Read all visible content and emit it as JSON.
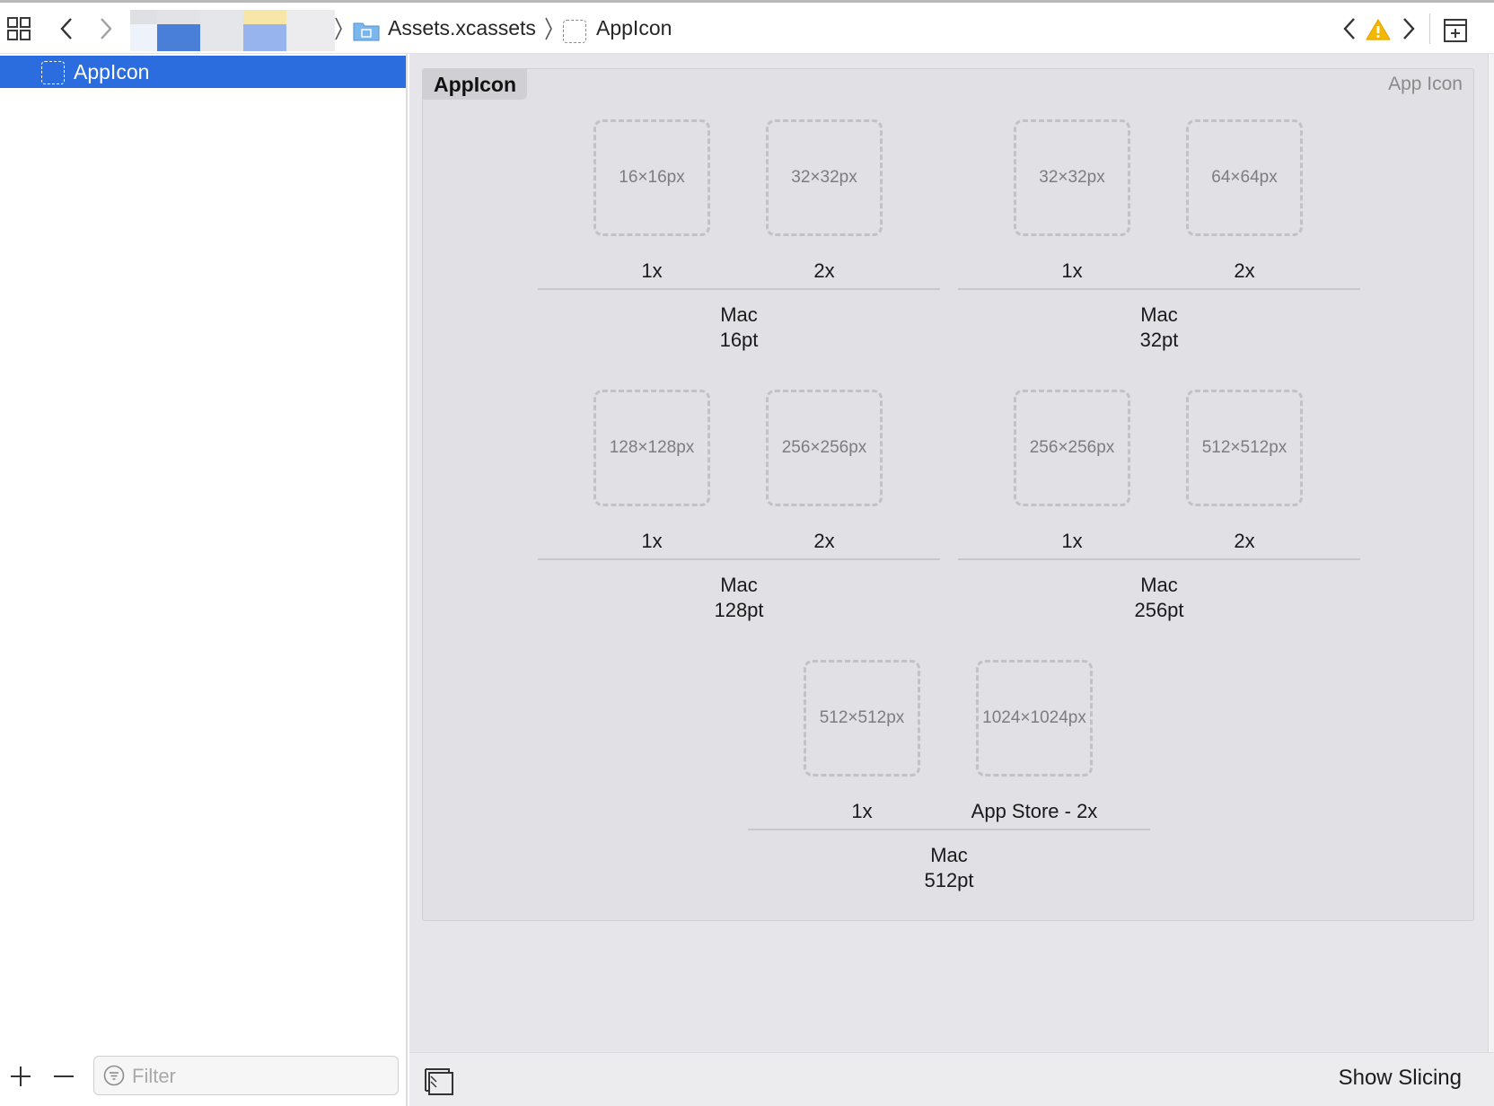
{
  "toolbar": {
    "breadcrumb": [
      "Assets.xcassets",
      "AppIcon"
    ]
  },
  "navigator": {
    "selected_item": "AppIcon",
    "filter_placeholder": "Filter"
  },
  "asset": {
    "name": "AppIcon",
    "type": "App Icon",
    "groups": [
      {
        "platform": "Mac",
        "size": "16pt",
        "slots": [
          {
            "px": "16×16px",
            "scale": "1x"
          },
          {
            "px": "32×32px",
            "scale": "2x"
          }
        ]
      },
      {
        "platform": "Mac",
        "size": "32pt",
        "slots": [
          {
            "px": "32×32px",
            "scale": "1x"
          },
          {
            "px": "64×64px",
            "scale": "2x"
          }
        ]
      },
      {
        "platform": "Mac",
        "size": "128pt",
        "slots": [
          {
            "px": "128×128px",
            "scale": "1x"
          },
          {
            "px": "256×256px",
            "scale": "2x"
          }
        ]
      },
      {
        "platform": "Mac",
        "size": "256pt",
        "slots": [
          {
            "px": "256×256px",
            "scale": "1x"
          },
          {
            "px": "512×512px",
            "scale": "2x"
          }
        ]
      },
      {
        "platform": "Mac",
        "size": "512pt",
        "slots": [
          {
            "px": "512×512px",
            "scale": "1x"
          },
          {
            "px": "1024×1024px",
            "scale": "App Store - 2x"
          }
        ]
      }
    ]
  },
  "bottom_bar": {
    "show_slicing": "Show Slicing"
  },
  "colors": {
    "selection": "#2b6cde",
    "warning": "#f5b800"
  }
}
